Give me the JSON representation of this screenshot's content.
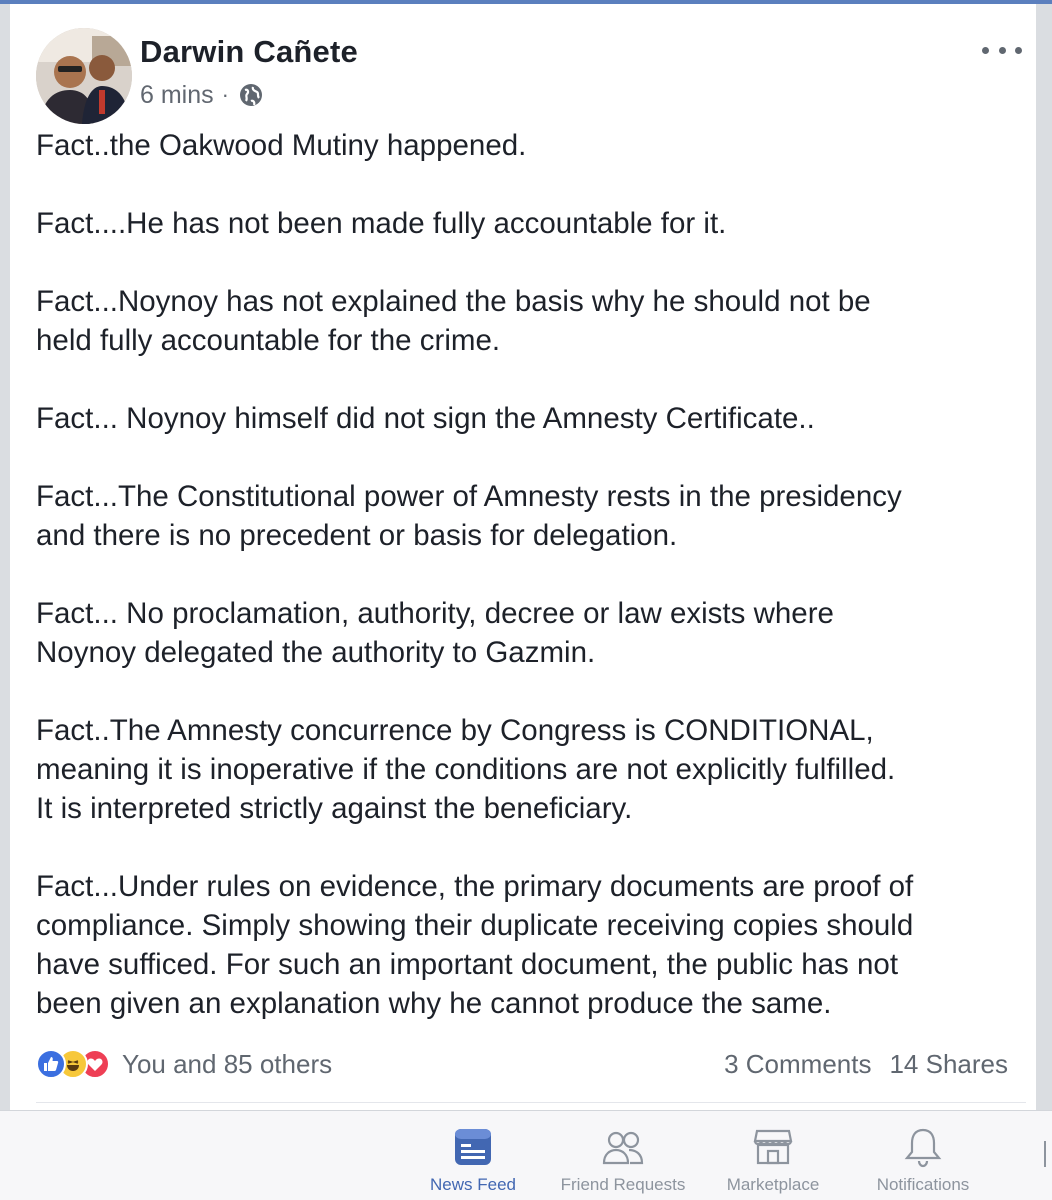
{
  "post": {
    "author": "Darwin Cañete",
    "time": "6 mins",
    "separator": "·",
    "privacy_icon": "globe-icon",
    "more_icon": "more-options-icon",
    "paragraphs": [
      "Fact..the Oakwood Mutiny happened.",
      "Fact....He has not been made fully accountable for it.",
      "Fact...Noynoy has not explained the basis why he should not be\nheld fully accountable for the crime.",
      "Fact... Noynoy himself did not sign the Amnesty Certificate..",
      "Fact...The Constitutional power of Amnesty rests in the presidency\nand there is no precedent or basis for delegation.",
      "Fact... No proclamation, authority, decree or law exists where\nNoynoy delegated the authority to Gazmin.",
      "Fact..The Amnesty concurrence by Congress is CONDITIONAL,\nmeaning it is inoperative if the conditions are not explicitly fulfilled.\nIt is interpreted strictly against the beneficiary.",
      "Fact...Under rules on evidence, the primary documents are proof of\ncompliance. Simply showing their duplicate receiving copies should\nhave sufficed. For such an important document, the public has not\nbeen given an explanation why he cannot produce the same."
    ],
    "reactions_text": "You and 85 others",
    "reaction_icons": [
      "like-icon",
      "haha-icon",
      "love-icon"
    ],
    "comments": "3 Comments",
    "shares": "14 Shares"
  },
  "colors": {
    "accent": "#4267b2",
    "like": "#3b6fe0",
    "haha": "#f7c83a",
    "love": "#ee3f55",
    "muted_text": "#606770"
  },
  "tabbar": {
    "tabs": [
      {
        "label": "News Feed",
        "icon": "news-feed-icon",
        "active": true
      },
      {
        "label": "Friend Requests",
        "icon": "friend-requests-icon",
        "active": false
      },
      {
        "label": "Marketplace",
        "icon": "marketplace-icon",
        "active": false
      },
      {
        "label": "Notifications",
        "icon": "notifications-icon",
        "active": false
      }
    ]
  }
}
